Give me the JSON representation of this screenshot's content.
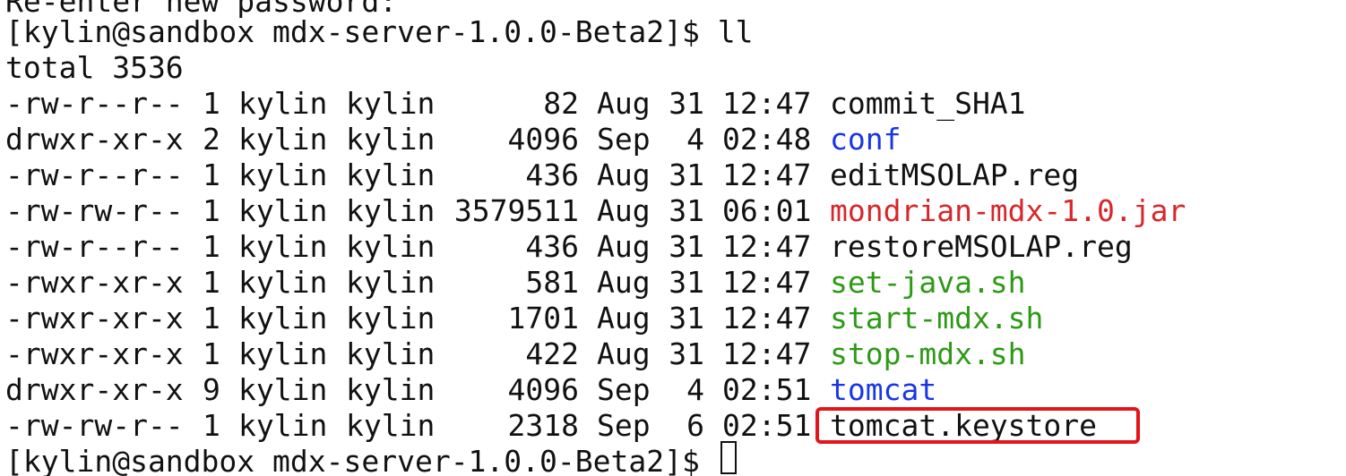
{
  "top_partial_line": "Re-enter new password:",
  "prompt_1": "[kylin@sandbox mdx-server-1.0.0-Beta2]$ ll",
  "total_line": "total 3536",
  "files": [
    {
      "perm": "-rw-r--r--",
      "links": "1",
      "user": "kylin",
      "group": "kylin",
      "size": "82",
      "month": "Aug",
      "day": "31",
      "time": "12:47",
      "name": "commit_SHA1",
      "color": "#111111"
    },
    {
      "perm": "drwxr-xr-x",
      "links": "2",
      "user": "kylin",
      "group": "kylin",
      "size": "4096",
      "month": "Sep",
      "day": "4",
      "time": "02:48",
      "name": "conf",
      "color": "#1737e6"
    },
    {
      "perm": "-rw-r--r--",
      "links": "1",
      "user": "kylin",
      "group": "kylin",
      "size": "436",
      "month": "Aug",
      "day": "31",
      "time": "12:47",
      "name": "editMSOLAP.reg",
      "color": "#111111"
    },
    {
      "perm": "-rw-rw-r--",
      "links": "1",
      "user": "kylin",
      "group": "kylin",
      "size": "3579511",
      "month": "Aug",
      "day": "31",
      "time": "06:01",
      "name": "mondrian-mdx-1.0.jar",
      "color": "#d8262a"
    },
    {
      "perm": "-rw-r--r--",
      "links": "1",
      "user": "kylin",
      "group": "kylin",
      "size": "436",
      "month": "Aug",
      "day": "31",
      "time": "12:47",
      "name": "restoreMSOLAP.reg",
      "color": "#111111"
    },
    {
      "perm": "-rwxr-xr-x",
      "links": "1",
      "user": "kylin",
      "group": "kylin",
      "size": "581",
      "month": "Aug",
      "day": "31",
      "time": "12:47",
      "name": "set-java.sh",
      "color": "#2d9a16"
    },
    {
      "perm": "-rwxr-xr-x",
      "links": "1",
      "user": "kylin",
      "group": "kylin",
      "size": "1701",
      "month": "Aug",
      "day": "31",
      "time": "12:47",
      "name": "start-mdx.sh",
      "color": "#2d9a16"
    },
    {
      "perm": "-rwxr-xr-x",
      "links": "1",
      "user": "kylin",
      "group": "kylin",
      "size": "422",
      "month": "Aug",
      "day": "31",
      "time": "12:47",
      "name": "stop-mdx.sh",
      "color": "#2d9a16"
    },
    {
      "perm": "drwxr-xr-x",
      "links": "9",
      "user": "kylin",
      "group": "kylin",
      "size": "4096",
      "month": "Sep",
      "day": "4",
      "time": "02:51",
      "name": "tomcat",
      "color": "#1737e6"
    },
    {
      "perm": "-rw-rw-r--",
      "links": "1",
      "user": "kylin",
      "group": "kylin",
      "size": "2318",
      "month": "Sep",
      "day": "6",
      "time": "02:51",
      "name": "tomcat.keystore",
      "color": "#111111"
    }
  ],
  "prompt_2": "[kylin@sandbox mdx-server-1.0.0-Beta2]$",
  "colors": {
    "background": "#ffffff",
    "text": "#111111",
    "directory": "#1737e6",
    "executable": "#2d9a16",
    "archive": "#d8262a",
    "highlight_border": "#e3151a"
  }
}
